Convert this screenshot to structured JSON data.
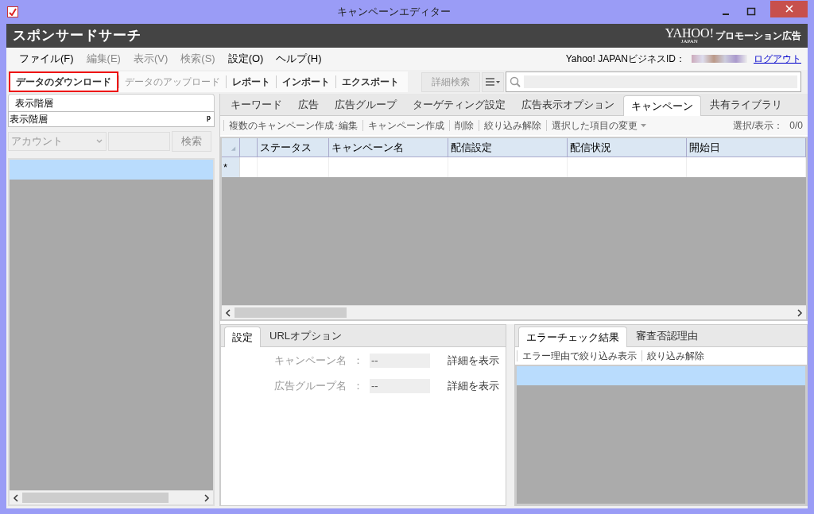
{
  "window": {
    "title": "キャンペーンエディター"
  },
  "header": {
    "title": "スポンサードサーチ",
    "logo_main": "YAHOO!",
    "logo_sub": "JAPAN",
    "logo_suffix": "プロモーション広告"
  },
  "menu": [
    {
      "label": "ファイル(F)",
      "disabled": false
    },
    {
      "label": "編集(E)",
      "disabled": true
    },
    {
      "label": "表示(V)",
      "disabled": true
    },
    {
      "label": "検索(S)",
      "disabled": true
    },
    {
      "label": "設定(O)",
      "disabled": false
    },
    {
      "label": "ヘルプ(H)",
      "disabled": false
    }
  ],
  "account": {
    "label": "Yahoo! JAPANビジネスID：",
    "logout": "ログアウト"
  },
  "toolbar": [
    {
      "label": "データのダウンロード",
      "selected": true,
      "disabled": false
    },
    {
      "label": "データのアップロード",
      "selected": false,
      "disabled": true
    },
    {
      "label": "レポート",
      "selected": false,
      "disabled": false
    },
    {
      "label": "インポート",
      "selected": false,
      "disabled": false
    },
    {
      "label": "エクスポート",
      "selected": false,
      "disabled": false
    }
  ],
  "search": {
    "advanced": "詳細検索"
  },
  "left_panel": {
    "tab": "表示階層",
    "title": "表示階層",
    "pin": "ᵖ",
    "combo": "アカウント",
    "search_button": "検索"
  },
  "tabs": [
    {
      "label": "キーワード",
      "selected": false
    },
    {
      "label": "広告",
      "selected": false
    },
    {
      "label": "広告グループ",
      "selected": false
    },
    {
      "label": "ターゲティング設定",
      "selected": false
    },
    {
      "label": "広告表示オプション",
      "selected": false
    },
    {
      "label": "キャンペーン",
      "selected": true
    },
    {
      "label": "共有ライブラリ",
      "selected": false
    }
  ],
  "actions": [
    "複数のキャンペーン作成･編集",
    "キャンペーン作成",
    "削除",
    "絞り込み解除",
    "選択した項目の変更"
  ],
  "selection_count": {
    "label": "選択/表示：",
    "value": "0/0"
  },
  "table": {
    "columns": [
      "ステータス",
      "キャンペーン名",
      "配信設定",
      "配信状況",
      "開始日"
    ],
    "new_row_marker": "*"
  },
  "settings_panel": {
    "tabs": [
      {
        "label": "設定",
        "selected": true
      },
      {
        "label": "URLオプション",
        "selected": false
      }
    ],
    "fields": [
      {
        "label": "キャンペーン名",
        "separator": "：",
        "value": "--",
        "link": "詳細を表示"
      },
      {
        "label": "広告グループ名",
        "separator": "：",
        "value": "--",
        "link": "詳細を表示"
      }
    ]
  },
  "error_panel": {
    "tabs": [
      {
        "label": "エラーチェック結果",
        "selected": true
      },
      {
        "label": "審査否認理由",
        "selected": false
      }
    ],
    "actions": [
      "エラー理由で絞り込み表示",
      "絞り込み解除"
    ]
  }
}
